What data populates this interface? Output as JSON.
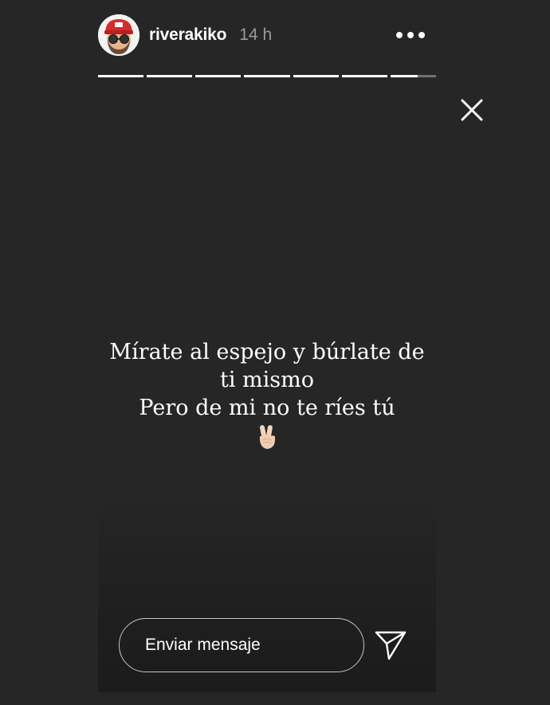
{
  "header": {
    "username": "riverakiko",
    "time": "14 h",
    "avatar_icon": "memoji-avatar-icon",
    "more_icon": "more-options-icon"
  },
  "progress": {
    "segments": 7,
    "current_segment": 7,
    "current_fraction": 0.6
  },
  "close_icon": "close-icon",
  "story": {
    "lines": [
      "Mírate al espejo y búrlate de",
      "ti mismo",
      "Pero de mi no te ríes tú"
    ],
    "emoji_icon": "victory-hand-icon"
  },
  "footer": {
    "message_placeholder": "Enviar mensaje",
    "send_icon": "send-icon"
  },
  "colors": {
    "background": "#262626",
    "text": "#ffffff",
    "muted": "#9a9a9a",
    "avatar_cap": "#d52b2b"
  }
}
